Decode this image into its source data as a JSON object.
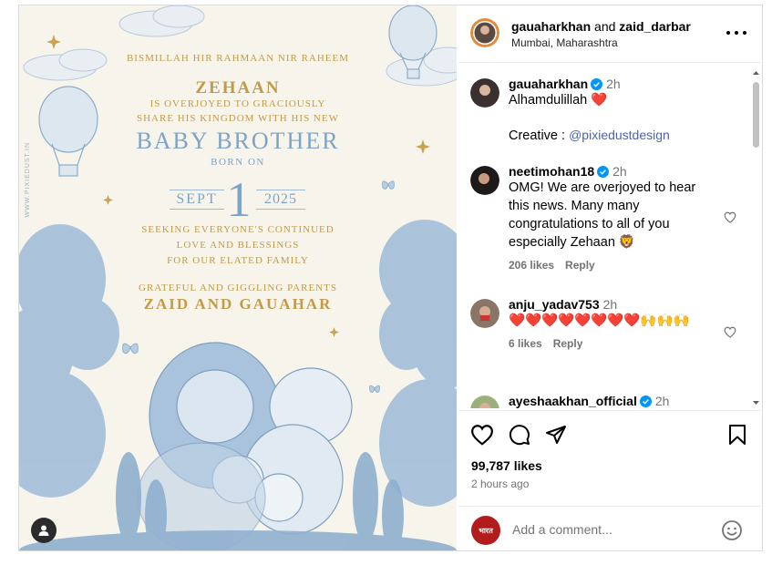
{
  "card": {
    "line1": "BISMILLAH HIR  RAHMAAN NIR RAHEEM",
    "baby_name": "ZEHAAN",
    "line2": "IS OVERJOYED TO GRACIOUSLY",
    "line3": "SHARE HIS KINGDOM WITH HIS NEW",
    "headline": "BABY BROTHER",
    "born_on": "BORN ON",
    "month": "SEPT",
    "day": "1",
    "year": "2025",
    "line4": "SEEKING EVERYONE'S CONTINUED",
    "line5": "LOVE AND BLESSINGS",
    "line6": "FOR OUR ELATED FAMILY",
    "line7": "GRATEFUL AND GIGGLING PARENTS",
    "parents": "ZAID AND GAUAHAR",
    "watermark": "WWW.PIXIEDUST.IN"
  },
  "header": {
    "user1": "gauaharkhan",
    "and_text": " and ",
    "user2": "zaid_darbar",
    "location": "Mumbai, Maharashtra"
  },
  "comments": [
    {
      "user": "gauaharkhan",
      "time": "2h",
      "text": "Alhamdulillah ❤️",
      "extra_label": "Creative : ",
      "link": "@pixiedustdesign"
    },
    {
      "user": "neetimohan18",
      "time": "2h",
      "text": "OMG! We are overjoyed to hear this news. Many many congratulations to all of you especially Zehaan 🦁",
      "likes": "206 likes",
      "reply": "Reply"
    },
    {
      "user": "anju_yadav753",
      "time": "2h",
      "text": "❤️❤️❤️❤️❤️❤️❤️❤️🙌🙌🙌",
      "likes": "6 likes",
      "reply": "Reply"
    },
    {
      "user": "ayeshaakhan_official",
      "time": "2h"
    }
  ],
  "footer": {
    "likes": "99,787 likes",
    "posted": "2 hours ago",
    "placeholder": "Add a comment...",
    "commenter_badge": "भारत"
  },
  "colors": {
    "verified": "#0095f6",
    "gold": "#c29a48",
    "blue": "#7ea3c6",
    "heart": "#e0202e"
  }
}
